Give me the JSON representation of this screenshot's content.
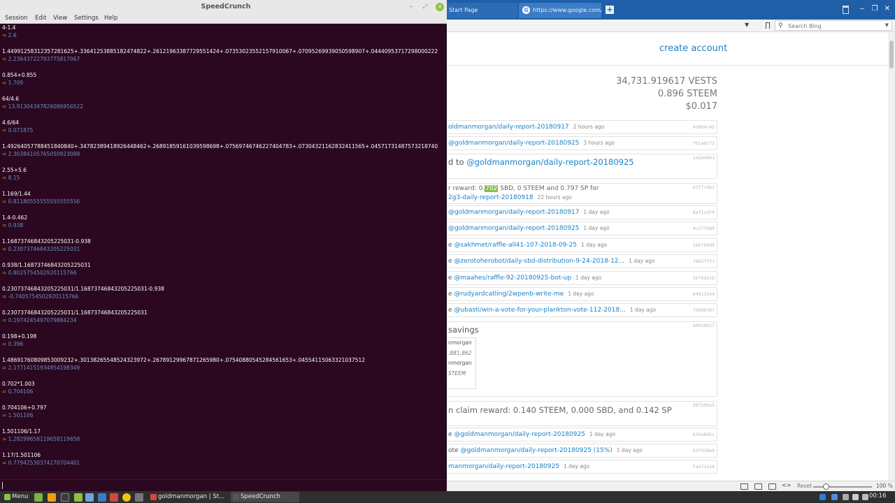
{
  "browser": {
    "tabs": [
      {
        "label": "Start Page"
      },
      {
        "label": "https://www.google.com/sr"
      }
    ],
    "search": {
      "placeholder": "Search Bing"
    },
    "page": {
      "create_account": "create account",
      "balances": [
        "34,731.919617 VESTS",
        "0.896 STEEM",
        "$0.017"
      ],
      "activity_top": [
        {
          "text": "oldmanmorgan/daily-report-20180917",
          "ago": "2 hours ago",
          "hash": "43004c45"
        },
        {
          "text": "@goldmanmorgan/daily-report-20180925",
          "ago": "3 hours ago",
          "hash": "fb1a6272"
        }
      ],
      "vote_big": {
        "prefix": "d to ",
        "link": "@goldmanmorgan/daily-report-20180925",
        "hash": "14294961"
      },
      "reward": {
        "prefix": "r reward: 0.",
        "highlight": "702",
        "suffix": " SBD, 0 STEEM and 0.797 SP for",
        "link": "2g3-daily-report-20180918",
        "ago": "22 hours ago",
        "hash": "e2f7cda1"
      },
      "activity_mid": [
        {
          "pre": "",
          "text": "@goldmanmorgan/daily-report-20180917",
          "ago": "1 day ago",
          "hash": "8af1cd74"
        },
        {
          "pre": "",
          "text": "@goldmanmorgan/daily-report-20180925",
          "ago": "1 day ago",
          "hash": "4c377680"
        },
        {
          "pre": "e ",
          "text": "@sakhmet/raffle-all41-107-2018-09-25",
          "ago": "1 day ago",
          "hash": "166fb9d0"
        },
        {
          "pre": "e ",
          "text": "@zerotoherobot/daily-sbd-distribution-9-24-2018-12...",
          "ago": "1 day ago",
          "hash": "7662ff33"
        },
        {
          "pre": "e ",
          "text": "@maahes/raffle-92-20180925-bot-up",
          "ago": "1 day ago",
          "hash": "5bf4da1b"
        },
        {
          "pre": "e ",
          "text": "@rudyardcatling/2wpenb-write-me",
          "ago": "1 day ago",
          "hash": "b4913144"
        },
        {
          "pre": "e ",
          "text": "@ubasti/win-a-vote-for-your-plankton-vote-112-2018...",
          "ago": "1 day ago",
          "hash": "7568b307"
        }
      ],
      "savings": {
        "title": "savings",
        "hash": "a0430627",
        "lines": [
          "nmorgan",
          ".881,862",
          "nmorgan",
          "STEEM"
        ]
      },
      "claim": {
        "text": "n claim reward: 0.140 STEEM, 0.000 SBD, and 0.142 SP",
        "hash": "d9f595e5"
      },
      "activity_bottom": [
        {
          "pre": "e ",
          "text": "@goldmanmorgan/daily-report-20180925",
          "ago": "1 day ago",
          "hash": "634ab65c"
        },
        {
          "pre": "ote ",
          "text": "@goldmanmorgan/daily-report-20180925 (15%)",
          "ago": "1 day ago",
          "hash": "02fd20e0"
        },
        {
          "pre": "",
          "text": "manmorgan/daily-report-20180925",
          "ago": "1 day ago",
          "hash": "fa471614"
        }
      ]
    },
    "status": {
      "reset": "Reset",
      "zoom": "100 %"
    }
  },
  "speedcrunch": {
    "title": "SpeedCrunch",
    "menu": [
      "Session",
      "Edit",
      "View",
      "Settings",
      "Help"
    ],
    "history": [
      {
        "expr": "4-1.4",
        "result": "2.6"
      },
      {
        "expr": "1.4499125831235728162​5+.3364125388518247482​2+.2612196338772955142​4+.0735302355215791006​7+.0709526993905059890​7+.0444095371729800022​2",
        "result": "2.2364372279377581706​7"
      },
      {
        "expr": "0.854+0.855",
        "result": "1.709"
      },
      {
        "expr": "64/4.6",
        "result": "13.913043478260869565​22"
      },
      {
        "expr": "4.6/64",
        "result": "0.071875"
      },
      {
        "expr": "1.4926405778845184084​0+.3478238941892644846​2+.2689185916103959869​8+.0756974674622740478​3+.0730432116283241156​5+.0457173148757321874​0",
        "result": "2.3038410576505092308​8"
      },
      {
        "expr": "2.55+5.6",
        "result": "8.15"
      },
      {
        "expr": "1.169/1.44",
        "result": "0.8118055555555555555​6"
      },
      {
        "expr": "1.4-0.462",
        "result": "0.938"
      },
      {
        "expr": "1.1687374684320522503​1-0.938",
        "result": "0.2307374684320522503​1"
      },
      {
        "expr": "0.938/1.1687374684320522503​1",
        "result": "0.8025754502920115766"
      },
      {
        "expr": "0.2307374684320522503​1/1.1687374684320522503​1-0.938",
        "result": "-0.7405754502920115766"
      },
      {
        "expr": "0.2307374684320522503​1/1.1687374684320522503​1",
        "result": "0.1974245497079884234"
      },
      {
        "expr": "0.198+0.198",
        "result": "0.396"
      },
      {
        "expr": "1.4869176080985300923​2+.3013826554852432397​2+.2678912996787126598​0+.0754088054528456165​3+.0455411506332103751​2",
        "result": "2.1771415193485419834​9"
      },
      {
        "expr": "0.702*1.003",
        "result": "0.704106"
      },
      {
        "expr": "0.704106+0.797",
        "result": "1.501106"
      },
      {
        "expr": "1.501106/1.17",
        "result": "1.2829965811965811965​8"
      },
      {
        "expr": "1.17/1.501106",
        "result": "0.7794253037427070440​1"
      }
    ]
  },
  "taskbar": {
    "menu_label": "Menu",
    "tasks": [
      "goldmanmorgan | St...",
      "SpeedCrunch"
    ],
    "clock": "00:16"
  },
  "colors": {
    "accent_link": "#1a81c7",
    "sc_background": "#2b0720",
    "mint_green": "#8fc046"
  }
}
